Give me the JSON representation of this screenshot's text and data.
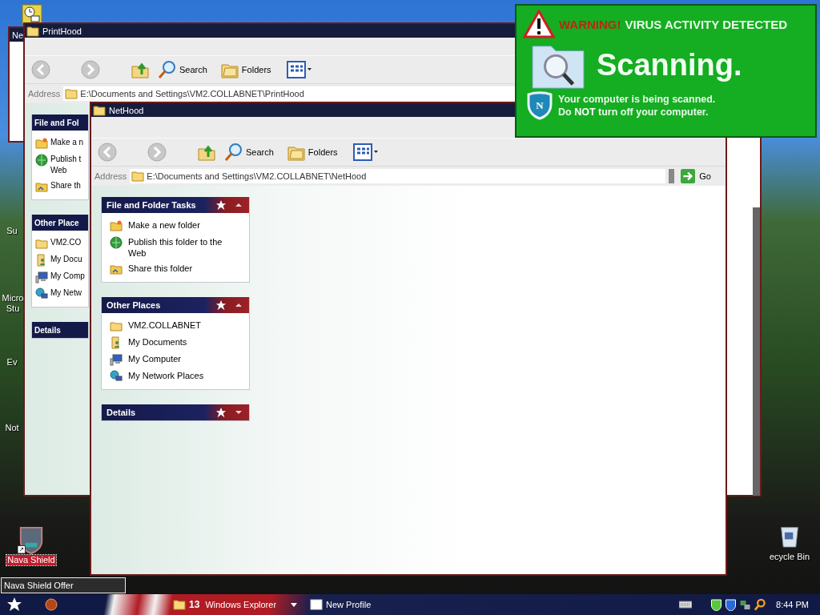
{
  "desktop_icons": [
    {
      "label": "Su",
      "selected": false
    },
    {
      "label": "Micro\nStu",
      "selected": false
    },
    {
      "label": "Ev",
      "selected": false
    },
    {
      "label": "Not",
      "selected": false
    },
    {
      "label": "Nava Shield",
      "selected": true
    },
    {
      "label": "ecycle Bin",
      "selected": false
    }
  ],
  "back_window": {
    "title": "Ne"
  },
  "printhood": {
    "title": "PrintHood",
    "toolbar": [
      {
        "label": "Search"
      },
      {
        "label": "Folders"
      }
    ],
    "address_label": "Address",
    "address": "E:\\Documents and Settings\\VM2.COLLABNET\\PrintHood",
    "panels": [
      {
        "title": "File and Fol",
        "expanded": true,
        "items": [
          {
            "kind": "newfolder",
            "label": "Make a n"
          },
          {
            "kind": "globe",
            "label": "Publish t\nWeb"
          },
          {
            "kind": "sharedfolder",
            "label": "Share th"
          }
        ]
      },
      {
        "title": "Other Place",
        "expanded": true,
        "items": [
          {
            "kind": "folder",
            "label": "VM2.CO"
          },
          {
            "kind": "documents",
            "label": "My Docu"
          },
          {
            "kind": "computer",
            "label": "My Comp"
          },
          {
            "kind": "network",
            "label": "My Netw"
          }
        ]
      },
      {
        "title": "Details",
        "expanded": false
      }
    ]
  },
  "nethood": {
    "title": "NetHood",
    "toolbar": [
      {
        "label": "Search"
      },
      {
        "label": "Folders"
      }
    ],
    "address_label": "Address",
    "address": "E:\\Documents and Settings\\VM2.COLLABNET\\NetHood",
    "go_label": "Go",
    "panels": [
      {
        "title": "File and Folder Tasks",
        "expanded": true,
        "items": [
          {
            "kind": "newfolder",
            "label": "Make a new folder"
          },
          {
            "kind": "globe",
            "label": "Publish this folder to the Web"
          },
          {
            "kind": "sharedfolder",
            "label": "Share this folder"
          }
        ]
      },
      {
        "title": "Other Places",
        "expanded": true,
        "items": [
          {
            "kind": "folder",
            "label": "VM2.COLLABNET"
          },
          {
            "kind": "documents",
            "label": "My Documents"
          },
          {
            "kind": "computer",
            "label": "My Computer"
          },
          {
            "kind": "network",
            "label": "My Network Places"
          }
        ]
      },
      {
        "title": "Details",
        "expanded": false
      }
    ]
  },
  "popup": {
    "logo_letter": "N",
    "warning": "WARNING!",
    "headline": "VIRUS ACTIVITY DETECTED",
    "status": "Scanning.",
    "message": "Your computer is being scanned.",
    "caution": "Do **NOT** turn off your computer."
  },
  "tooltip": "Nava Shield Offer",
  "taskbar": {
    "buttons": [
      {
        "kind": "group",
        "count": "13",
        "label": "Windows Explorer"
      },
      {
        "kind": "window",
        "label": "New Profile"
      }
    ],
    "clock": "8:44 PM"
  }
}
